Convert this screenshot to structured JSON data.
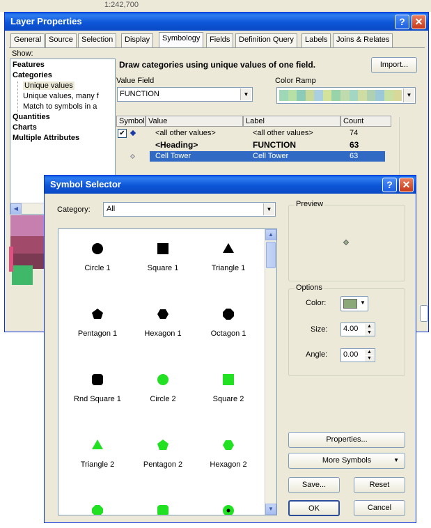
{
  "background_toolbar": {
    "text": "1:242,700"
  },
  "layer_properties": {
    "title": "Layer Properties",
    "help_glyph": "?",
    "close_glyph": "✕",
    "tabs": [
      "General",
      "Source",
      "Selection",
      "Display",
      "Symbology",
      "Fields",
      "Definition Query",
      "Labels",
      "Joins & Relates"
    ],
    "active_tab": "Symbology",
    "show_label": "Show:",
    "show_tree": {
      "features": "Features",
      "categories": "Categories",
      "unique_values": "Unique values",
      "unique_values_many": "Unique values, many f",
      "match_to_symbols": "Match to symbols in a",
      "quantities": "Quantities",
      "charts": "Charts",
      "multiple_attributes": "Multiple Attributes"
    },
    "heading": "Draw categories using unique values of one field.",
    "import_button": "Import...",
    "value_field_label": "Value Field",
    "value_field_value": "FUNCTION",
    "color_ramp_label": "Color Ramp",
    "color_ramp_colors": [
      "#9fd8b7",
      "#b7e0a6",
      "#8ccbb8",
      "#c8d99a",
      "#a9cfe0",
      "#d4e39c",
      "#98d3a9",
      "#c0dcae",
      "#a4d6c4",
      "#cfdca3",
      "#b0d0b4",
      "#9cc9d8",
      "#c9e0a4",
      "#d8d89a"
    ],
    "table": {
      "headers": [
        "Symbol",
        "Value",
        "Label",
        "Count"
      ],
      "rows": [
        {
          "value": "<all other values>",
          "label": "<all other values>",
          "count": "74"
        },
        {
          "value": "<Heading>",
          "label": "FUNCTION",
          "count": "63"
        },
        {
          "value": "Cell Tower",
          "label": "Cell Tower",
          "count": "63"
        }
      ],
      "selected_color": "#316ac5"
    },
    "legend_colors": [
      "#c77fb0",
      "#a14a6a",
      "#7b3a52",
      "#3fb86a",
      "#e05080"
    ]
  },
  "symbol_selector": {
    "title": "Symbol Selector",
    "help_glyph": "?",
    "close_glyph": "✕",
    "category_label": "Category:",
    "category_value": "All",
    "preview_label": "Preview",
    "options_label": "Options",
    "color_label": "Color:",
    "color_value": "#8aa878",
    "size_label": "Size:",
    "size_value": "4.00",
    "angle_label": "Angle:",
    "angle_value": "0.00",
    "properties_button": "Properties...",
    "more_symbols_button": "More Symbols",
    "save_button": "Save...",
    "reset_button": "Reset",
    "ok_button": "OK",
    "cancel_button": "Cancel",
    "symbols": [
      {
        "label": "Circle 1",
        "shape": "circle",
        "color": "#000000"
      },
      {
        "label": "Square 1",
        "shape": "square",
        "color": "#000000"
      },
      {
        "label": "Triangle 1",
        "shape": "triangle",
        "color": "#000000"
      },
      {
        "label": "Pentagon 1",
        "shape": "pentagon",
        "color": "#000000"
      },
      {
        "label": "Hexagon 1",
        "shape": "hexagon",
        "color": "#000000"
      },
      {
        "label": "Octagon 1",
        "shape": "octagon",
        "color": "#000000"
      },
      {
        "label": "Rnd Square 1",
        "shape": "rndsquare",
        "color": "#000000"
      },
      {
        "label": "Circle 2",
        "shape": "circle",
        "color": "#22e022"
      },
      {
        "label": "Square 2",
        "shape": "square",
        "color": "#22e022"
      },
      {
        "label": "Triangle 2",
        "shape": "triangle",
        "color": "#22e022"
      },
      {
        "label": "Pentagon 2",
        "shape": "pentagon",
        "color": "#22e022"
      },
      {
        "label": "Hexagon 2",
        "shape": "hexagon",
        "color": "#22e022"
      },
      {
        "label": "",
        "shape": "octagon",
        "color": "#22e022"
      },
      {
        "label": "",
        "shape": "rndsquare",
        "color": "#22e022"
      },
      {
        "label": "",
        "shape": "dotcircle",
        "color": "#22e022"
      }
    ]
  }
}
